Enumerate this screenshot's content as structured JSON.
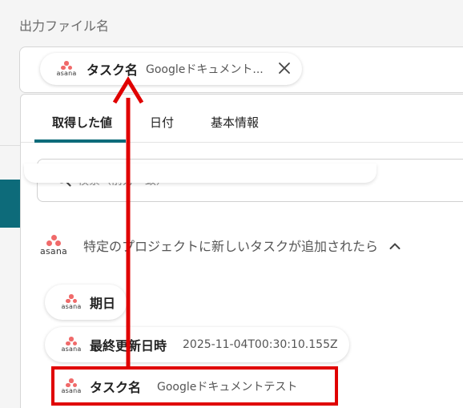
{
  "field": {
    "label": "出力ファイル名",
    "chip": {
      "name": "タスク名",
      "value": "Googleドキュメント...",
      "close_icon": "close-icon"
    }
  },
  "panel": {
    "tabs": [
      "取得した値",
      "日付",
      "基本情報"
    ],
    "active_tab": 0,
    "search_placeholder": "検索（前方一致）",
    "section_title": "特定のプロジェクトに新しいタスクが追加されたら",
    "items": [
      {
        "name": "期日",
        "value": ""
      },
      {
        "name": "最終更新日時",
        "value": "2025-11-04T00:30:10.155Z"
      },
      {
        "name": "タスク名",
        "value": "Googleドキュメントテスト"
      }
    ]
  },
  "asana_label": "asana",
  "colors": {
    "accent": "#0d6b7a",
    "annotation": "#e00000",
    "asana": "#f06a6a"
  }
}
